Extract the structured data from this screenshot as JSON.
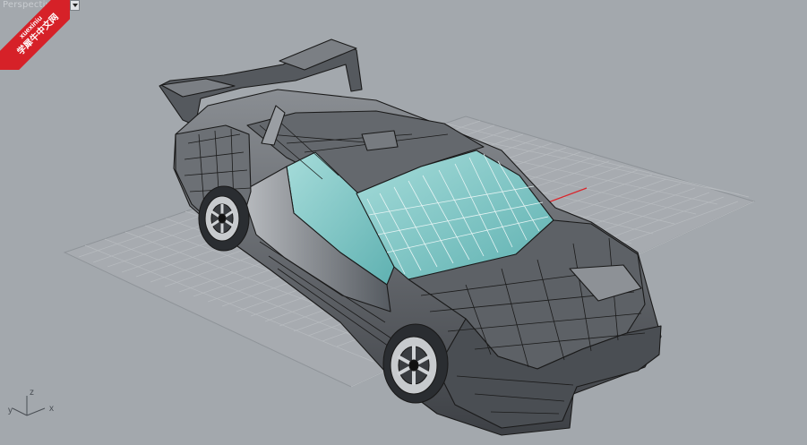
{
  "viewport": {
    "title": "Perspective",
    "background": "#a3a8ad"
  },
  "watermark": {
    "line1": "xuexiniu",
    "line2": "学犀牛中文网",
    "color": "#d62128"
  },
  "axis_widget": {
    "z_label": "z",
    "y_label": "y",
    "x_label": "x"
  },
  "colors": {
    "grid": "#b9bdc1",
    "grid_major": "#8e9398",
    "x_axis": "#d8262c",
    "car_wire": "#1a1a1a",
    "car_surface": "#6f7378",
    "glass": "#7fc7c7"
  },
  "icons": {
    "dropdown": "chevron-down-icon"
  }
}
